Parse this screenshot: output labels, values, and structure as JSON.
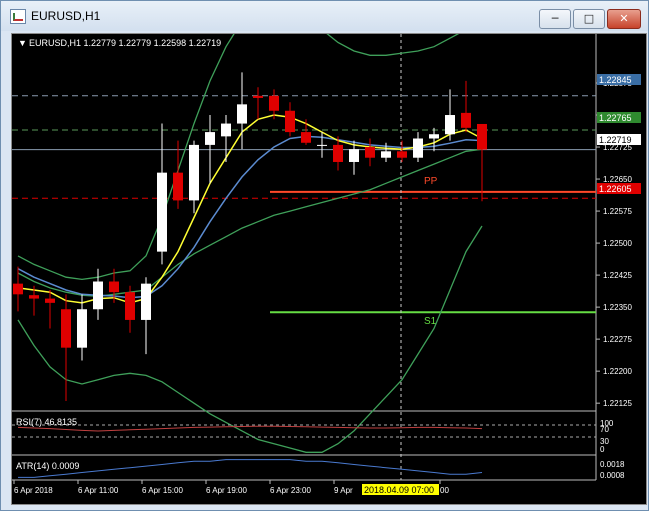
{
  "window": {
    "title": "EURUSD,H1",
    "min_icon": "minimize-icon",
    "max_icon": "maximize-icon",
    "close_icon": "close-icon"
  },
  "chart_header": {
    "text": "EURUSD,H1  1.22779 1.22779 1.22598 1.22719"
  },
  "colors": {
    "background": "#000000",
    "bull": "#ffffff",
    "bear": "#e00000",
    "ma_fast": "#ffff33",
    "ma_slow": "#5b8bd0",
    "band": "#3fa05a",
    "level_line": "#ff4a2a",
    "support": "#66dd44"
  },
  "labels": {
    "pp": "PP",
    "s1": "S1",
    "time_highlight": "2018.04.09 07:00"
  },
  "price_labels": {
    "pl_22845": "1.22845",
    "pl_22765": "1.22765",
    "pl_22719": "1.22719",
    "pl_22605": "1.22605"
  },
  "rsi": {
    "label": "RSI(7) 46.8135",
    "levels": [
      "100",
      "70",
      "30",
      "0"
    ]
  },
  "atr": {
    "label": "ATR(14) 0.0009",
    "levels": [
      "0.0018",
      "0.0008"
    ]
  },
  "chart_data": {
    "type": "candlestick",
    "symbol": "EURUSD",
    "timeframe": "H1",
    "ohlc_last": {
      "open": 1.22779,
      "high": 1.22779,
      "low": 1.22598,
      "close": 1.22719
    },
    "y_ticks": [
      1.22875,
      1.228,
      1.22725,
      1.2265,
      1.22575,
      1.225,
      1.22425,
      1.2235,
      1.22275,
      1.222,
      1.22125
    ],
    "y_tick_labels": [
      "1.22875",
      "1.22800",
      "1.22725",
      "1.22650",
      "1.22575",
      "1.22500",
      "1.22425",
      "1.22350",
      "1.22275",
      "1.22200",
      "1.22125"
    ],
    "ylim": [
      1.22109,
      1.22957
    ],
    "x_tick_labels": [
      "6 Apr 2018",
      "6 Apr 11:00",
      "6 Apr 15:00",
      "6 Apr 19:00",
      "6 Apr 23:00",
      "9 Apr",
      "00"
    ],
    "candles": [
      {
        "o": 1.22405,
        "h": 1.22445,
        "l": 1.2234,
        "c": 1.2238
      },
      {
        "o": 1.22378,
        "h": 1.224,
        "l": 1.2233,
        "c": 1.2237
      },
      {
        "o": 1.2237,
        "h": 1.2239,
        "l": 1.223,
        "c": 1.2236
      },
      {
        "o": 1.22345,
        "h": 1.2238,
        "l": 1.2213,
        "c": 1.22255
      },
      {
        "o": 1.22255,
        "h": 1.2238,
        "l": 1.22225,
        "c": 1.22345
      },
      {
        "o": 1.22345,
        "h": 1.2244,
        "l": 1.2232,
        "c": 1.2241
      },
      {
        "o": 1.2241,
        "h": 1.2244,
        "l": 1.2236,
        "c": 1.22385
      },
      {
        "o": 1.22385,
        "h": 1.224,
        "l": 1.2229,
        "c": 1.2232
      },
      {
        "o": 1.2232,
        "h": 1.2242,
        "l": 1.2224,
        "c": 1.22405
      },
      {
        "o": 1.2248,
        "h": 1.2278,
        "l": 1.2245,
        "c": 1.22665
      },
      {
        "o": 1.22665,
        "h": 1.2274,
        "l": 1.2258,
        "c": 1.226
      },
      {
        "o": 1.226,
        "h": 1.2274,
        "l": 1.2257,
        "c": 1.2273
      },
      {
        "o": 1.2273,
        "h": 1.228,
        "l": 1.2264,
        "c": 1.2276
      },
      {
        "o": 1.2275,
        "h": 1.228,
        "l": 1.2269,
        "c": 1.2278
      },
      {
        "o": 1.2278,
        "h": 1.229,
        "l": 1.2272,
        "c": 1.22825
      },
      {
        "o": 1.22845,
        "h": 1.22865,
        "l": 1.2279,
        "c": 1.2284
      },
      {
        "o": 1.22845,
        "h": 1.2286,
        "l": 1.2279,
        "c": 1.2281
      },
      {
        "o": 1.2281,
        "h": 1.2283,
        "l": 1.2275,
        "c": 1.2276
      },
      {
        "o": 1.2276,
        "h": 1.2279,
        "l": 1.2273,
        "c": 1.22735
      },
      {
        "o": 1.2273,
        "h": 1.2276,
        "l": 1.227,
        "c": 1.2273
      },
      {
        "o": 1.2273,
        "h": 1.2275,
        "l": 1.2267,
        "c": 1.2269
      },
      {
        "o": 1.2269,
        "h": 1.2274,
        "l": 1.2266,
        "c": 1.2272
      },
      {
        "o": 1.22725,
        "h": 1.22745,
        "l": 1.2268,
        "c": 1.227
      },
      {
        "o": 1.227,
        "h": 1.22735,
        "l": 1.2269,
        "c": 1.22715
      },
      {
        "o": 1.22715,
        "h": 1.2274,
        "l": 1.2269,
        "c": 1.227
      },
      {
        "o": 1.227,
        "h": 1.2276,
        "l": 1.2269,
        "c": 1.22745
      },
      {
        "o": 1.22745,
        "h": 1.2277,
        "l": 1.22715,
        "c": 1.22755
      },
      {
        "o": 1.22755,
        "h": 1.2286,
        "l": 1.2274,
        "c": 1.228
      },
      {
        "o": 1.22805,
        "h": 1.2288,
        "l": 1.2276,
        "c": 1.2277
      },
      {
        "o": 1.22779,
        "h": 1.22779,
        "l": 1.22598,
        "c": 1.22719
      }
    ],
    "ma_fast": [
      1.22395,
      1.2239,
      1.22385,
      1.22365,
      1.2236,
      1.2237,
      1.22372,
      1.2236,
      1.2237,
      1.2242,
      1.2248,
      1.2256,
      1.2264,
      1.227,
      1.2276,
      1.2279,
      1.228,
      1.22795,
      1.2278,
      1.2276,
      1.2274,
      1.2273,
      1.22725,
      1.22722,
      1.2272,
      1.22725,
      1.22735,
      1.22755,
      1.22765,
      1.22745
    ],
    "ma_slow": [
      1.2244,
      1.2242,
      1.22405,
      1.2239,
      1.2238,
      1.22378,
      1.22376,
      1.22372,
      1.22375,
      1.224,
      1.2244,
      1.2249,
      1.2255,
      1.22605,
      1.22655,
      1.22695,
      1.22725,
      1.22745,
      1.2275,
      1.22748,
      1.22742,
      1.22736,
      1.2273,
      1.22727,
      1.22724,
      1.22724,
      1.22727,
      1.22734,
      1.22742,
      1.2274
    ],
    "band_upper": [
      1.2247,
      1.2245,
      1.22435,
      1.2242,
      1.22415,
      1.2242,
      1.2243,
      1.22435,
      1.2247,
      1.2256,
      1.2267,
      1.2278,
      1.2288,
      1.2296,
      1.2302,
      1.2305,
      1.2306,
      1.2305,
      1.2303,
      1.23,
      1.2297,
      1.2295,
      1.2294,
      1.2294,
      1.22945,
      1.2295,
      1.2296,
      1.2298,
      1.23,
      1.2301
    ],
    "band_middle": [
      1.2243,
      1.2241,
      1.22395,
      1.22385,
      1.22378,
      1.22375,
      1.2238,
      1.22385,
      1.2239,
      1.2242,
      1.2245,
      1.22475,
      1.22495,
      1.22515,
      1.22535,
      1.2255,
      1.22565,
      1.22575,
      1.22585,
      1.22595,
      1.22605,
      1.22615,
      1.22625,
      1.2264,
      1.22655,
      1.2267,
      1.22685,
      1.227,
      1.22715,
      1.2272
    ],
    "band_lower": [
      1.2232,
      1.2226,
      1.2221,
      1.2218,
      1.2217,
      1.2218,
      1.2219,
      1.22195,
      1.2219,
      1.22175,
      1.2215,
      1.22125,
      1.221,
      1.2208,
      1.2206,
      1.2204,
      1.2203,
      1.2202,
      1.2201,
      1.2201,
      1.2203,
      1.2206,
      1.221,
      1.2214,
      1.2218,
      1.2224,
      1.223,
      1.2239,
      1.2248,
      1.2254
    ],
    "levels": {
      "pp": 1.2262,
      "s1": 1.22338,
      "dashed_1": 1.22845,
      "dashed_2": 1.22765,
      "last_price": 1.22719,
      "red_dashed": 1.22605
    },
    "rsi_values": [
      62,
      60,
      58,
      55,
      52,
      50,
      52,
      54,
      56,
      58,
      60,
      62,
      63,
      64,
      65,
      66,
      66,
      65,
      64,
      63,
      62,
      61,
      60,
      60,
      61,
      62,
      62,
      61,
      60,
      58
    ],
    "atr_values": [
      0.0006,
      0.0006,
      0.0007,
      0.0008,
      0.0009,
      0.001,
      0.0011,
      0.0012,
      0.0013,
      0.0014,
      0.0015,
      0.0016,
      0.0016,
      0.0017,
      0.0017,
      0.0017,
      0.0017,
      0.0017,
      0.0016,
      0.0016,
      0.0015,
      0.0014,
      0.0013,
      0.0012,
      0.0011,
      0.001,
      0.0009,
      0.0008,
      0.0008,
      0.0009
    ]
  }
}
